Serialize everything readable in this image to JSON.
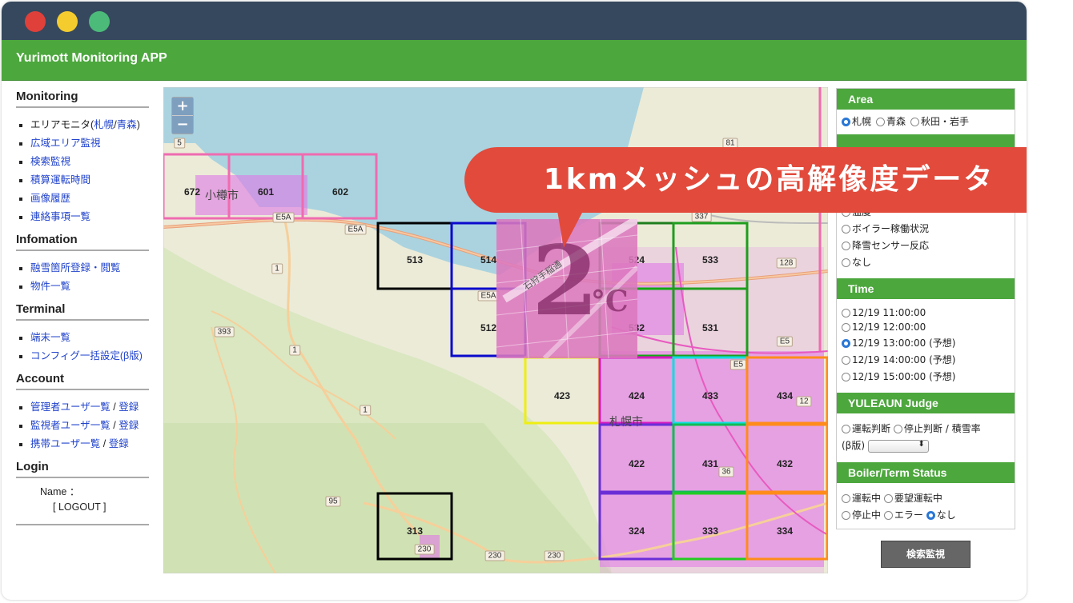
{
  "app": {
    "title": "Yurimott Monitoring APP"
  },
  "nav": {
    "monitoring": {
      "heading": "Monitoring",
      "area_monitor_prefix": "エリアモニタ(",
      "area_monitor_sapporo": "札幌",
      "area_monitor_sep": "/",
      "area_monitor_aomori": "青森",
      "area_monitor_suffix": ")",
      "items": [
        "広域エリア監視",
        "検索監視",
        "積算運転時間",
        "画像履歴",
        "連絡事項一覧"
      ]
    },
    "information": {
      "heading": "Infomation",
      "items": [
        "融雪箇所登録・閲覧",
        "物件一覧"
      ]
    },
    "terminal": {
      "heading": "Terminal",
      "items": [
        "端末一覧",
        "コンフィグ一括設定(β版)"
      ]
    },
    "account": {
      "heading": "Account",
      "rows": [
        {
          "label": "管理者ユーザ一覧",
          "register": "登録"
        },
        {
          "label": "監視者ユーザ一覧",
          "register": "登録"
        },
        {
          "label": "携帯ユーザ一覧",
          "register": "登録"
        }
      ],
      "separator": "/"
    },
    "login": {
      "heading": "Login",
      "name_label": "Name ：",
      "logout": "[ LOGOUT ]"
    }
  },
  "map": {
    "zoom_in": "+",
    "zoom_out": "−",
    "meshes": [
      "672",
      "601",
      "602",
      "513",
      "514",
      "524",
      "533",
      "512",
      "532",
      "531",
      "423",
      "424",
      "433",
      "434",
      "422",
      "431",
      "432",
      "313",
      "324",
      "333",
      "334"
    ],
    "roads": [
      "5",
      "81",
      "337",
      "E5A",
      "E5A",
      "1",
      "128",
      "393",
      "1",
      "E5A",
      "E5",
      "1",
      "12",
      "E5",
      "95",
      "230",
      "230",
      "230",
      "36"
    ],
    "places": [
      "小樽市",
      "札幌市"
    ]
  },
  "panel": {
    "area": {
      "heading": "Area",
      "options": [
        "札幌",
        "青森",
        "秋田・岩手"
      ],
      "selected": "札幌"
    },
    "view": {
      "options": [
        "温度",
        "ボイラー稼働状況",
        "降雪センサー反応",
        "なし"
      ]
    },
    "time": {
      "heading": "Time",
      "options": [
        "12/19 11:00:00",
        "12/19 12:00:00",
        "12/19 13:00:00 (予想)",
        "12/19 14:00:00 (予想)",
        "12/19 15:00:00 (予想)"
      ],
      "selected": "12/19 13:00:00 (予想)"
    },
    "judge": {
      "heading": "YULEAUN Judge",
      "options": [
        "運転判断",
        "停止判断"
      ],
      "sep": "/",
      "rate_label": "積雪率",
      "beta": "(β版)",
      "select_arrow": "⬍"
    },
    "status": {
      "heading": "Boiler/Term Status",
      "options": [
        "運転中",
        "要望運転中",
        "停止中",
        "エラー",
        "なし"
      ],
      "selected": "なし"
    },
    "search_button": "検索監視"
  },
  "overlay": {
    "tile_value": "2",
    "tile_unit": "°C",
    "tile_street": "石狩手稲通",
    "callout": "1kmメッシュの高解像度データ"
  },
  "colors": {
    "header": "#36485d",
    "accent_green": "#4ca73d",
    "callout_red": "#e24a3b",
    "link": "#2244cc"
  }
}
